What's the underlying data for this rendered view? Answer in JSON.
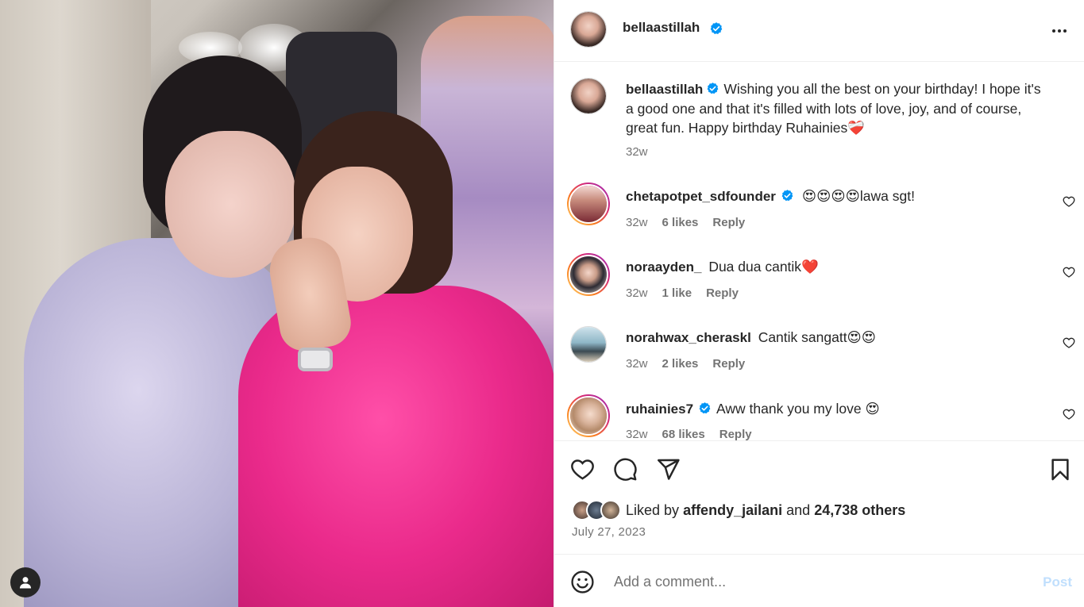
{
  "post": {
    "username": "bellaastillah",
    "verified": true,
    "caption": "Wishing you all the best on your birthday! I hope it's a good one and that it's filled with lots of love, joy, and of course, great fun. Happy birthday Ruhainies❤️‍🩹",
    "caption_time": "32w",
    "liked_by_prefix": "Liked by",
    "liked_by_user": "affendy_jailani",
    "liked_by_and": "and",
    "liked_by_others": "24,738 others",
    "date": "July 27, 2023"
  },
  "comments": [
    {
      "username": "chetapotpet_sdfounder",
      "verified": true,
      "text": "😍😍😍😍lawa sgt!",
      "time": "32w",
      "likes": "6 likes",
      "reply": "Reply"
    },
    {
      "username": "noraayden_",
      "verified": false,
      "text": "Dua dua cantik❤️",
      "time": "32w",
      "likes": "1 like",
      "reply": "Reply"
    },
    {
      "username": "norahwax_cheraskl",
      "verified": false,
      "text": "Cantik sangatt😍😍",
      "time": "32w",
      "likes": "2 likes",
      "reply": "Reply"
    },
    {
      "username": "ruhainies7",
      "verified": true,
      "text": "Aww thank you my love 😍",
      "time": "32w",
      "likes": "68 likes",
      "reply": "Reply"
    }
  ],
  "composer": {
    "placeholder": "Add a comment...",
    "post_label": "Post"
  },
  "icons": {
    "verified": "verified-badge-icon",
    "more": "more-options-icon",
    "like": "heart-icon",
    "comment": "comment-icon",
    "share": "share-icon",
    "save": "bookmark-icon",
    "emoji": "emoji-icon",
    "profile": "profile-icon"
  },
  "colors": {
    "verified": "#0095f6",
    "post_disabled": "#c0dffd",
    "secondary_text": "#737373"
  }
}
